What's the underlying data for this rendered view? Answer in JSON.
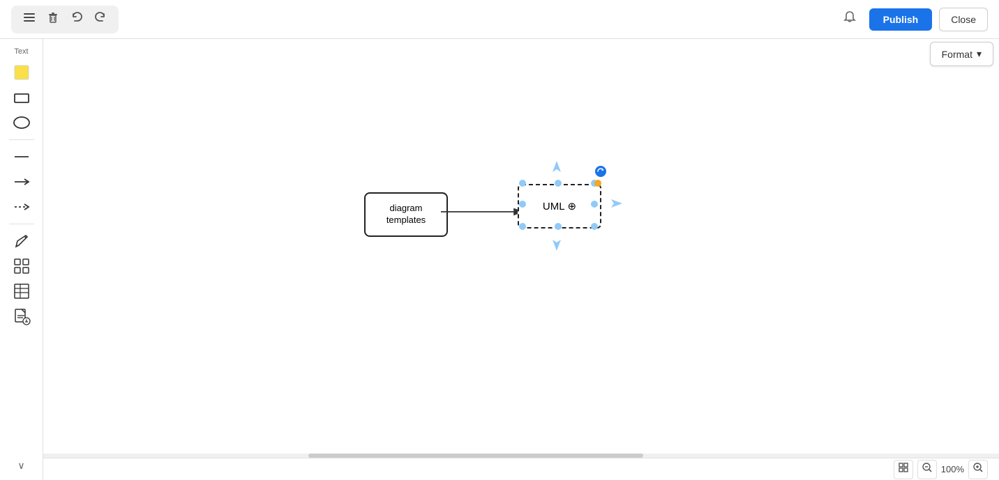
{
  "toolbar": {
    "menu_icon": "☰",
    "delete_icon": "🗑",
    "undo_icon": "↩",
    "redo_icon": "↪",
    "publish_label": "Publish",
    "close_label": "Close"
  },
  "format_panel": {
    "label": "Format",
    "chevron": "▾"
  },
  "sidebar": {
    "text_label": "Text",
    "items": [
      {
        "name": "sticky-note",
        "shape": "sticky"
      },
      {
        "name": "rectangle",
        "shape": "rect"
      },
      {
        "name": "ellipse",
        "shape": "ellipse"
      },
      {
        "name": "line",
        "shape": "line"
      },
      {
        "name": "arrow",
        "shape": "arrow"
      },
      {
        "name": "dashed-line",
        "shape": "dashed"
      },
      {
        "name": "pen",
        "shape": "pen"
      },
      {
        "name": "grid-shapes",
        "shape": "grid"
      },
      {
        "name": "table",
        "shape": "table"
      },
      {
        "name": "import",
        "shape": "import"
      }
    ],
    "collapse_icon": "∨"
  },
  "canvas": {
    "shape1": {
      "label": "diagram\ntemplates"
    },
    "shape2": {
      "label": "UML"
    },
    "move_cursor": "⊕"
  },
  "statusbar": {
    "fit_icon": "⊡",
    "zoom_out_icon": "🔍",
    "zoom_level": "100%",
    "zoom_in_icon": "🔍"
  }
}
